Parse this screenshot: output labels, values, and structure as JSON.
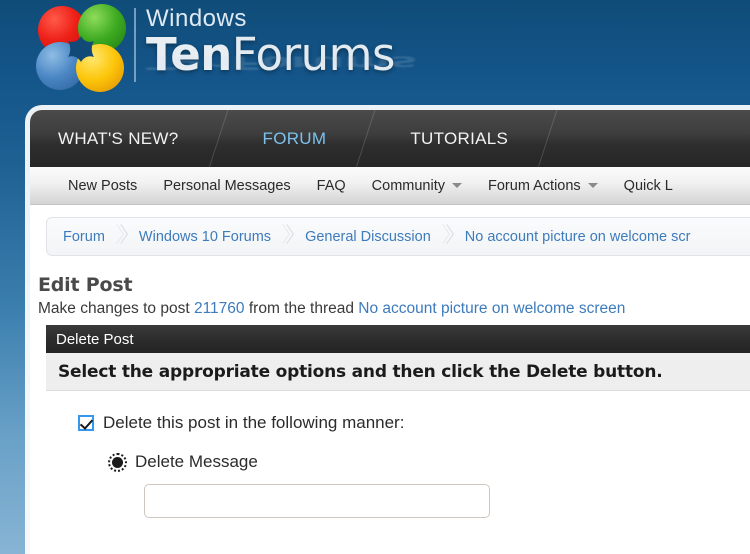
{
  "site": {
    "logo": {
      "brand_small": "Windows",
      "brand_main_bold": "Ten",
      "brand_main_thin": "Forums",
      "brand_full": "TenForums",
      "mark_icon": "windows-flag-spheres-icon",
      "sphere_colors": {
        "top_left": "#ee2018",
        "top_right": "#3eab22",
        "bottom_left": "#4a86c4",
        "bottom_right": "#fcc60a",
        "center": "#0f4c78"
      },
      "background_top": "#0f4c78",
      "background_bottom": "#87b4d4"
    }
  },
  "nav": {
    "active_color": "#7cc0ee",
    "tabs": [
      {
        "label": "WHAT'S NEW?",
        "active": false
      },
      {
        "label": "FORUM",
        "active": true
      },
      {
        "label": "TUTORIALS",
        "active": false
      }
    ]
  },
  "subnav": {
    "items": [
      {
        "label": "New Posts",
        "has_caret": false
      },
      {
        "label": "Personal Messages",
        "has_caret": false
      },
      {
        "label": "FAQ",
        "has_caret": false
      },
      {
        "label": "Community",
        "has_caret": true
      },
      {
        "label": "Forum Actions",
        "has_caret": true
      },
      {
        "label": "Quick L",
        "has_caret": false
      }
    ]
  },
  "breadcrumb": {
    "link_color": "#3d7bbd",
    "items": [
      "Forum",
      "Windows 10 Forums",
      "General Discussion",
      "No account picture on welcome scr"
    ]
  },
  "edit_post": {
    "title": "Edit Post",
    "subtitle_prefix": "Make changes to post ",
    "post_id": "211760",
    "subtitle_middle": " from the thread ",
    "thread_title": "No account picture on welcome screen"
  },
  "panel": {
    "header": "Delete Post",
    "banner": "Select the appropriate options and then click the Delete button.",
    "checkbox": {
      "label": "Delete this post in the following manner:",
      "checked": true,
      "accent_color": "#3399ee"
    },
    "radio": {
      "label": "Delete Message",
      "selected": true,
      "icon": "radio-selected-focused-icon"
    },
    "reason_input": {
      "value": "",
      "placeholder": ""
    }
  }
}
